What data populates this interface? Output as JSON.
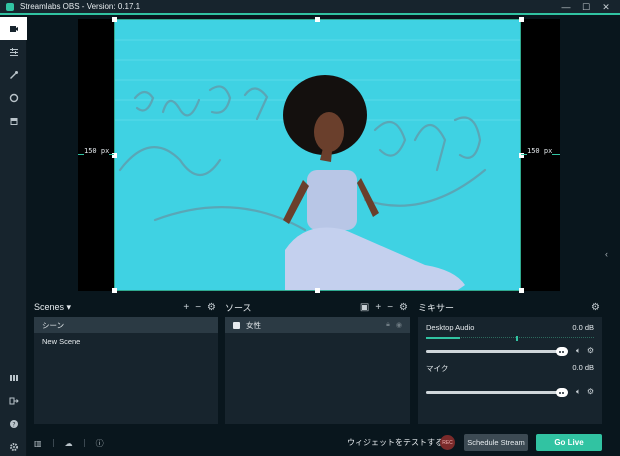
{
  "window": {
    "title": "Streamlabs OBS - Version: 0.17.1",
    "controls": [
      "—",
      "☐",
      "✕"
    ]
  },
  "nav": {
    "top_items": [
      "studio-editor-icon",
      "mixer-settings-icon",
      "themes-icon",
      "chat-icon",
      "store-icon"
    ],
    "bottom_items": [
      "layout-icon",
      "logout-icon",
      "help-icon",
      "settings-icon"
    ]
  },
  "preview": {
    "left_guide_label": "150 px",
    "right_guide_label": "150 px"
  },
  "scenes": {
    "title": "Scenes",
    "items": [
      {
        "label": "シーン",
        "selected": true
      },
      {
        "label": "New Scene",
        "selected": false
      }
    ]
  },
  "sources": {
    "title": "ソース",
    "items": [
      {
        "label": "女性",
        "selected": true
      }
    ]
  },
  "mixer": {
    "title": "ミキサー",
    "channels": [
      {
        "name": "Desktop Audio",
        "db": "0.0 dB",
        "volume": 0.97,
        "has_meter": true
      },
      {
        "name": "マイク",
        "db": "0.0 dB",
        "volume": 0.97,
        "has_meter": false
      }
    ]
  },
  "footer": {
    "widget_test_label": "ウィジェットをテストする",
    "rec_label": "REC",
    "schedule_label": "Schedule Stream",
    "go_live_label": "Go Live"
  },
  "colors": {
    "accent": "#31c3a2",
    "panel": "#17242d",
    "background": "#09161d"
  }
}
